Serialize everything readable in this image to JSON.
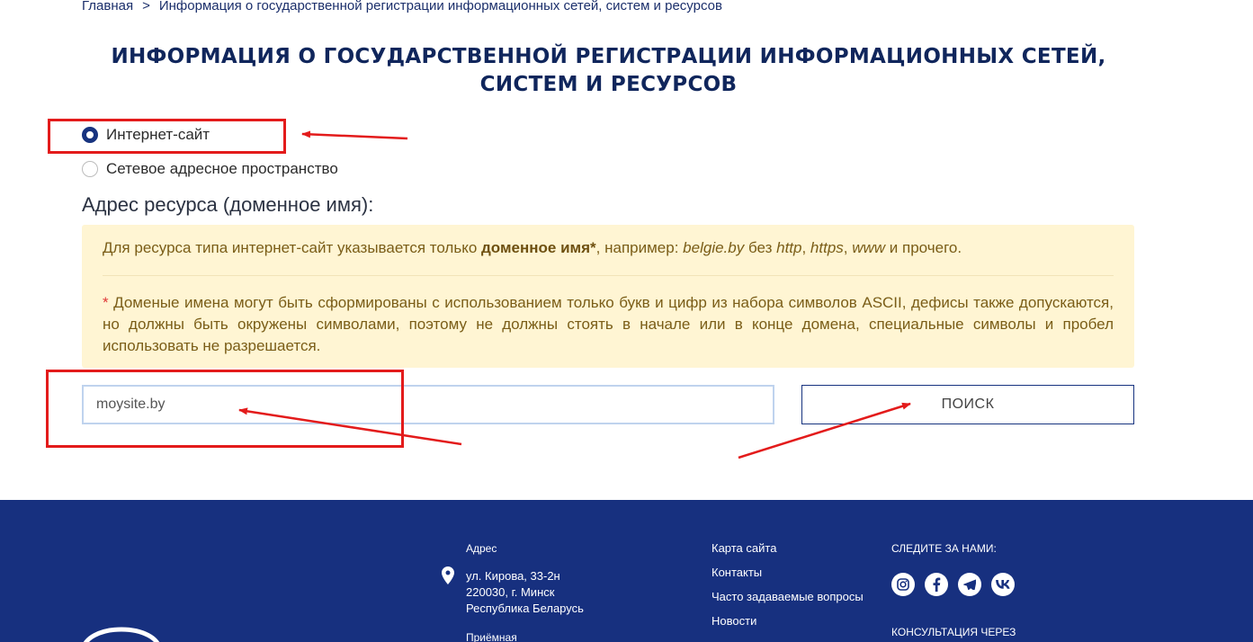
{
  "breadcrumb": {
    "home": "Главная",
    "separator": ">",
    "current": "Информация о государственной регистрации информационных сетей, систем и ресурсов"
  },
  "page_title": "ИНФОРМАЦИЯ О ГОСУДАРСТВЕННОЙ РЕГИСТРАЦИИ ИНФОРМАЦИОННЫХ СЕТЕЙ, СИСТЕМ И РЕСУРСОВ",
  "resource_type": {
    "options": [
      {
        "label": "Интернет-сайт",
        "selected": true
      },
      {
        "label": "Сетевое адресное пространство",
        "selected": false
      }
    ]
  },
  "address_label": "Адрес ресурса (доменное имя):",
  "notice": {
    "text_before": "Для ресурса типа интернет-сайт указывается только ",
    "bold": "доменное имя",
    "star": "*",
    "text_middle": ", например: ",
    "example": "belgie.by",
    "text_without": " без ",
    "http": "http",
    "comma1": ", ",
    "https": "https",
    "comma2": ", ",
    "www": "www",
    "text_end": " и прочего.",
    "note_star": "*",
    "note": " Доменые имена могут быть сформированы с использованием только букв и цифр из набора символов ASCII, дефисы также допускаются, но должны быть окружены символами, поэтому не должны стоять в начале или в конце домена, специальные символы и пробел использовать не разрешается."
  },
  "domain_input": {
    "value": "moysite.by"
  },
  "search_button": "ПОИСК",
  "footer": {
    "address_heading": "Адрес",
    "address_lines": [
      "ул. Кирова, 33-2н",
      "220030, г. Минск",
      "Республика Беларусь"
    ],
    "reception_heading": "Приёмная",
    "links": [
      "Карта сайта",
      "Контакты",
      "Часто задаваемые вопросы",
      "Новости"
    ],
    "follow_heading": "СЛЕДИТЕ ЗА НАМИ:",
    "social": [
      "instagram-icon",
      "facebook-icon",
      "telegram-icon",
      "vk-icon"
    ],
    "consult_heading": "КОНСУЛЬТАЦИЯ ЧЕРЕЗ"
  },
  "colors": {
    "primary": "#17307f",
    "notice_bg": "#fff5d3",
    "annotation_red": "#e31b1b"
  }
}
